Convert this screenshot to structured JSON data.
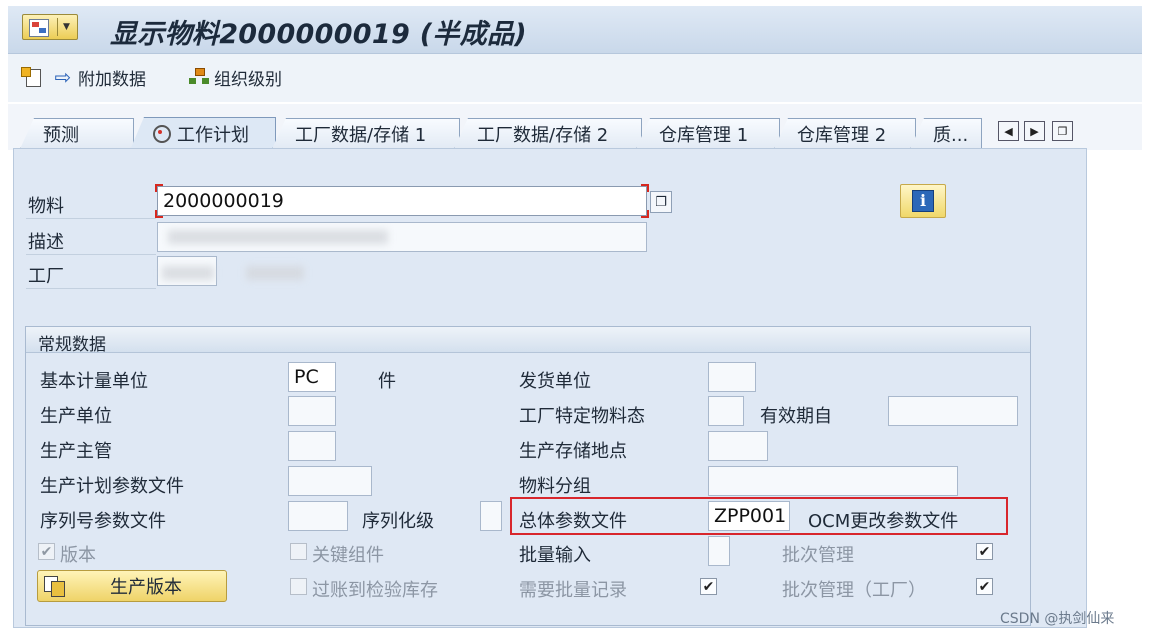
{
  "header": {
    "title": "显示物料2000000019 (半成品)"
  },
  "toolbar": {
    "additional_data": "附加数据",
    "org_levels": "组织级别"
  },
  "tabs": [
    {
      "label": "预测"
    },
    {
      "label": "工作计划"
    },
    {
      "label": "工厂数据/存储 1"
    },
    {
      "label": "工厂数据/存储 2"
    },
    {
      "label": "仓库管理 1"
    },
    {
      "label": "仓库管理 2"
    },
    {
      "label": "质..."
    }
  ],
  "header_fields": {
    "material_label": "物料",
    "material_value": "2000000019",
    "description_label": "描述",
    "plant_label": "工厂"
  },
  "general": {
    "section_title": "常规数据",
    "left": {
      "base_uom_label": "基本计量单位",
      "base_uom_value": "PC",
      "base_uom_text": "件",
      "prod_unit_label": "生产单位",
      "prod_supervisor_label": "生产主管",
      "prod_sched_profile_label": "生产计划参数文件",
      "serial_profile_label": "序列号参数文件",
      "serialization_label": "序列化级",
      "version_label": "版本",
      "key_component_label": "关键组件",
      "post_to_insp_label": "过账到检验库存",
      "prod_version_button": "生产版本"
    },
    "right": {
      "issue_unit_label": "发货单位",
      "plant_status_label": "工厂特定物料态",
      "valid_from_label": "有效期自",
      "prod_storage_loc_label": "生产存储地点",
      "material_group_label": "物料分组",
      "overall_profile_label": "总体参数文件",
      "overall_profile_value": "ZPP001",
      "overall_profile_text": "OCM更改参数文件",
      "batch_entry_label": "批量输入",
      "batch_mgmt_label": "批次管理",
      "batch_record_label": "需要批量记录",
      "batch_mgmt_plant_label": "批次管理（工厂）"
    },
    "checks": {
      "version": true,
      "key_component": false,
      "post_to_insp": false,
      "batch_mgmt": true,
      "batch_record": true,
      "batch_mgmt_plant": true
    }
  },
  "watermark": "CSDN @执剑仙来"
}
